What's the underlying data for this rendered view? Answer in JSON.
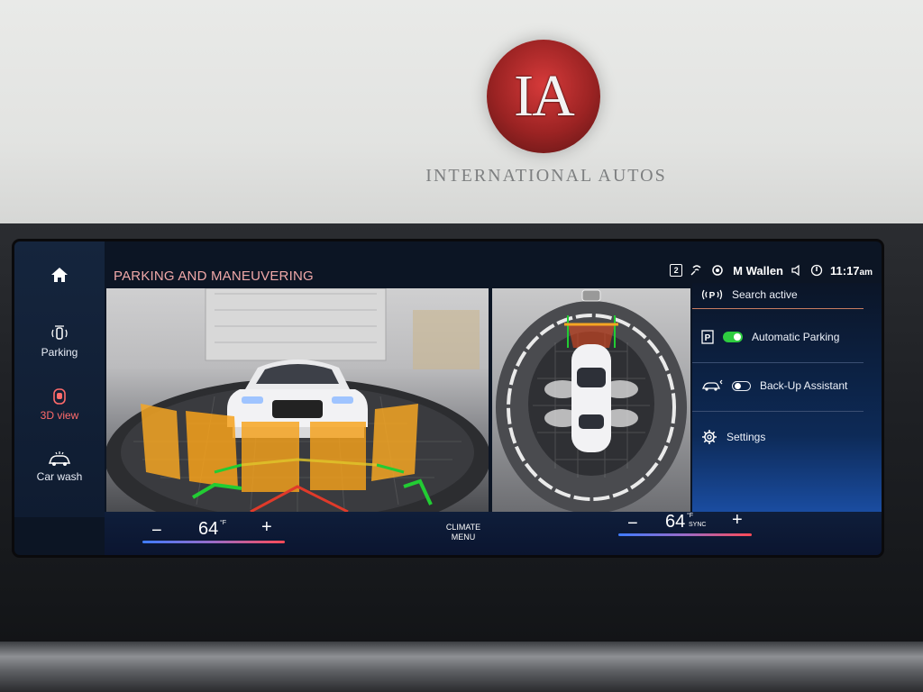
{
  "background": {
    "logo_letters": "IA",
    "logo_text": "INTERNATIONAL AUTOS"
  },
  "header": {
    "title": "PARKING AND MANEUVERING",
    "status_badge": "2",
    "user": "M Wallen",
    "time": "11:17",
    "ampm": "am"
  },
  "sidebar": {
    "items": [
      {
        "label": "",
        "icon": "home-icon"
      },
      {
        "label": "Parking",
        "icon": "parking-sensor-icon"
      },
      {
        "label": "3D view",
        "icon": "car-3d-icon",
        "active": true
      },
      {
        "label": "Car wash",
        "icon": "car-wash-icon"
      }
    ]
  },
  "panel": {
    "search": "Search active",
    "items": [
      {
        "label": "Automatic Parking",
        "icon": "parking-p-icon",
        "toggle": "on"
      },
      {
        "label": "Back-Up Assistant",
        "icon": "backup-assistant-icon",
        "toggle": "off"
      },
      {
        "label": "Settings",
        "icon": "gear-icon"
      }
    ]
  },
  "climate": {
    "left_minus": "−",
    "left_temp": "64",
    "left_unit": "°F",
    "left_plus": "+",
    "menu_line1": "CLIMATE",
    "menu_line2": "MENU",
    "right_minus": "−",
    "right_temp": "64",
    "right_unit_top": "°F",
    "right_unit_bottom": "SYNC",
    "right_plus": "+"
  },
  "colors": {
    "accent_active": "#ff6b6b",
    "toggle_on": "#2ecc40",
    "title": "#f0a8a8"
  }
}
